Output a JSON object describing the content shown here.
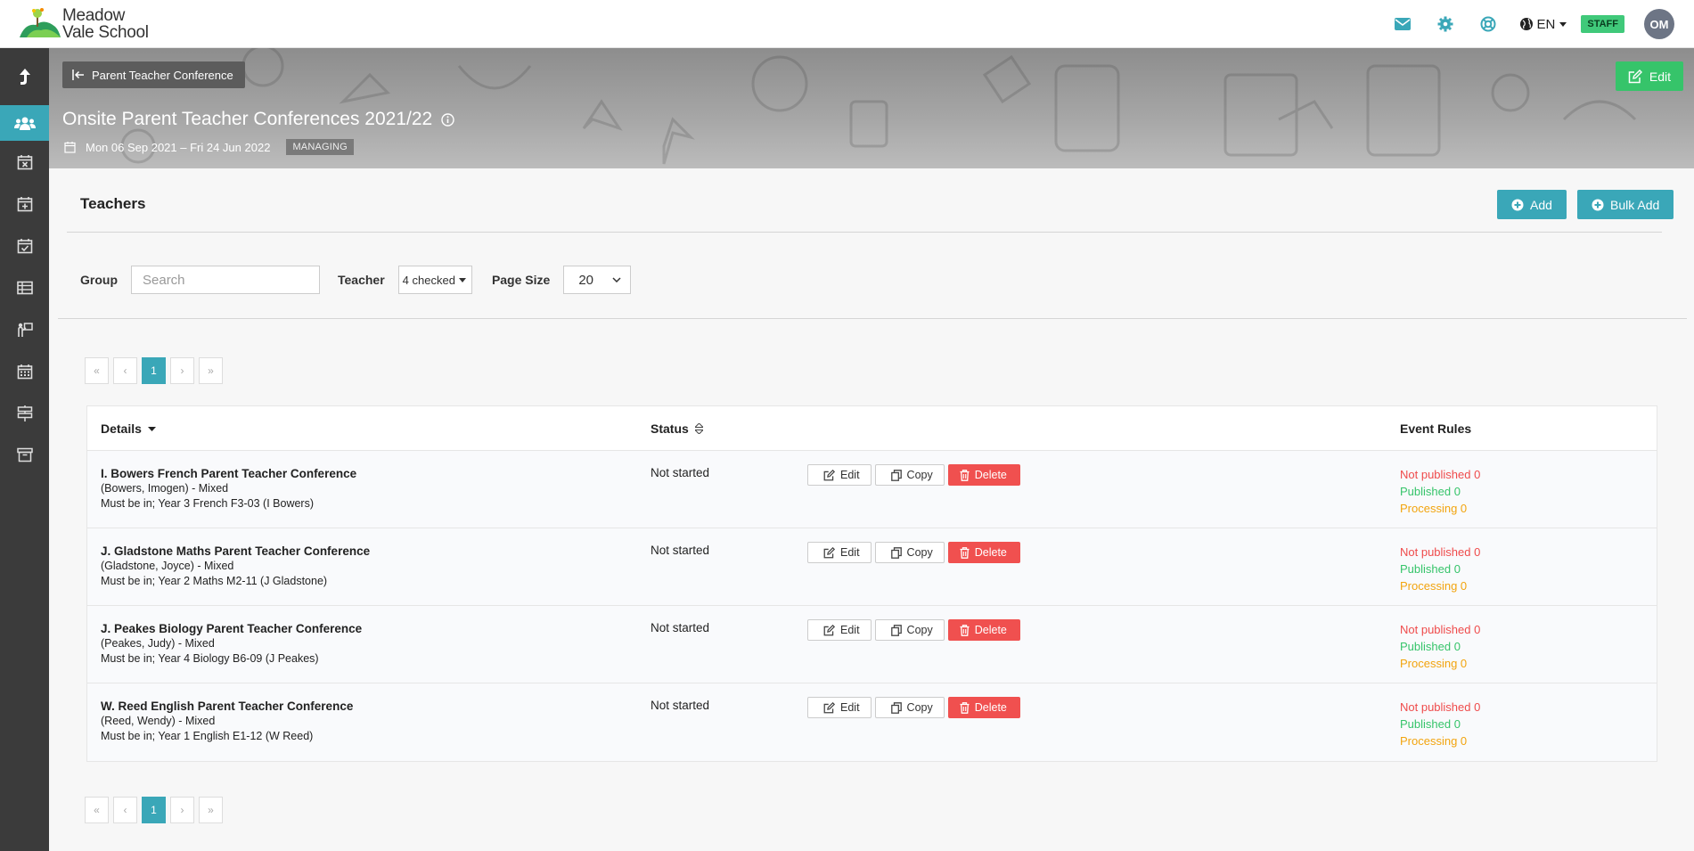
{
  "header": {
    "logo_line1": "Meadow",
    "logo_line2": "Vale School",
    "language": "EN",
    "role_badge": "STAFF",
    "avatar_initials": "OM",
    "icons": [
      "mail-icon",
      "gear-icon",
      "lifebuoy-icon",
      "globe-icon"
    ]
  },
  "sidebar": {
    "items": [
      "up-arrow-icon",
      "users-icon",
      "calendar-x-icon",
      "calendar-plus-icon",
      "calendar-check-icon",
      "table-icon",
      "person-board-icon",
      "calendar-grid-icon",
      "signpost-icon",
      "archive-icon"
    ],
    "active_index": 1
  },
  "banner": {
    "back_label": "Parent Teacher Conference",
    "edit_label": "Edit",
    "title": "Onsite Parent Teacher Conferences 2021/22",
    "date_range": "Mon 06 Sep 2021 – Fri 24 Jun 2022",
    "status_tag": "MANAGING"
  },
  "section": {
    "title": "Teachers",
    "add_label": "Add",
    "bulk_add_label": "Bulk Add"
  },
  "filters": {
    "group_label": "Group",
    "search_placeholder": "Search",
    "teacher_label": "Teacher",
    "teacher_value": "4 checked",
    "page_size_label": "Page Size",
    "page_size_value": "20"
  },
  "pagination": {
    "first": "«",
    "prev": "‹",
    "current": "1",
    "next": "›",
    "last": "»"
  },
  "table": {
    "headers": {
      "details": "Details",
      "status": "Status",
      "event_rules": "Event Rules"
    },
    "action_labels": {
      "edit": "Edit",
      "copy": "Copy",
      "delete": "Delete"
    },
    "rows": [
      {
        "name": "I. Bowers French Parent Teacher Conference",
        "teacher": "(Bowers, Imogen) - Mixed",
        "requirement": "Must be in; Year 3 French F3-03 (I Bowers)",
        "status": "Not started",
        "not_published": "Not published 0",
        "published": "Published 0",
        "processing": "Processing 0"
      },
      {
        "name": "J. Gladstone Maths Parent Teacher Conference",
        "teacher": "(Gladstone, Joyce) - Mixed",
        "requirement": "Must be in; Year 2 Maths M2-11 (J Gladstone)",
        "status": "Not started",
        "not_published": "Not published 0",
        "published": "Published 0",
        "processing": "Processing 0"
      },
      {
        "name": "J. Peakes Biology Parent Teacher Conference",
        "teacher": "(Peakes, Judy) - Mixed",
        "requirement": "Must be in; Year 4 Biology B6-09 (J Peakes)",
        "status": "Not started",
        "not_published": "Not published 0",
        "published": "Published 0",
        "processing": "Processing 0"
      },
      {
        "name": "W. Reed English Parent Teacher Conference",
        "teacher": "(Reed, Wendy) - Mixed",
        "requirement": "Must be in; Year 1 English E1-12 (W Reed)",
        "status": "Not started",
        "not_published": "Not published 0",
        "published": "Published 0",
        "processing": "Processing 0"
      }
    ]
  },
  "colors": {
    "accent": "#3aa7b8",
    "success": "#36c46a",
    "danger": "#f0504f",
    "warning": "#f2a40e",
    "sidebar": "#3b3b3b"
  }
}
